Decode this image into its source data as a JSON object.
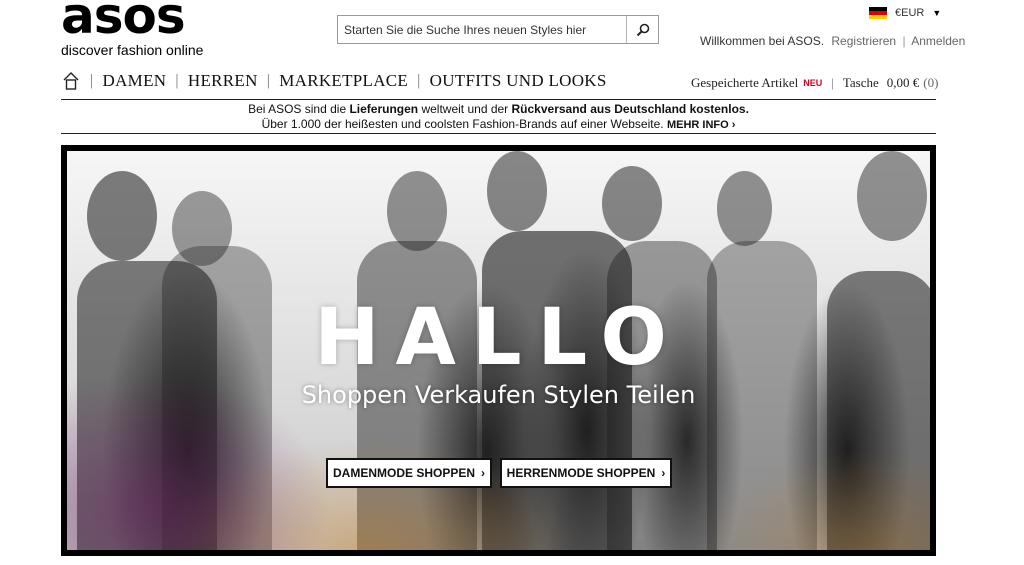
{
  "logo": {
    "wordmark": "asos",
    "tagline": "discover fashion online"
  },
  "search": {
    "placeholder": "Starten Sie die Suche Ihres neuen Styles hier",
    "icon": "search-icon"
  },
  "currency": {
    "label": "€EUR",
    "flag": "germany-flag-icon",
    "flag_colors": [
      "#000000",
      "#dd0000",
      "#ffce00"
    ]
  },
  "account": {
    "welcome": "Willkommen bei ASOS.",
    "register": "Registrieren",
    "separator": "|",
    "login": "Anmelden"
  },
  "nav": {
    "home_icon": "home-icon",
    "items": [
      "DAMEN",
      "HERREN",
      "MARKETPLACE",
      "OUTFITS UND LOOKS"
    ],
    "saved": {
      "label": "Gespeicherte Artikel",
      "badge": "NEU"
    },
    "bag": {
      "label": "Tasche",
      "amount": "0,00 €",
      "count": "(0)"
    }
  },
  "promo": {
    "line1_pre": "Bei ASOS sind die ",
    "line1_b1": "Lieferungen",
    "line1_mid": " weltweit und der ",
    "line1_b2": "Rückversand aus Deutschland kostenlos.",
    "line2": "Über 1.000 der heißesten und coolsten Fashion-Brands auf einer Webseite.",
    "more": "MEHR INFO",
    "more_chevron": "›"
  },
  "hero": {
    "title": "HALLO",
    "subtitle": "Shoppen Verkaufen Stylen Teilen",
    "buttons": [
      {
        "label": "DAMENMODE SHOPPEN",
        "chevron": "›"
      },
      {
        "label": "HERRENMODE SHOPPEN",
        "chevron": "›"
      }
    ]
  },
  "colors": {
    "badge_red": "#d4001c",
    "text": "#222222",
    "link_gray": "#666666"
  }
}
